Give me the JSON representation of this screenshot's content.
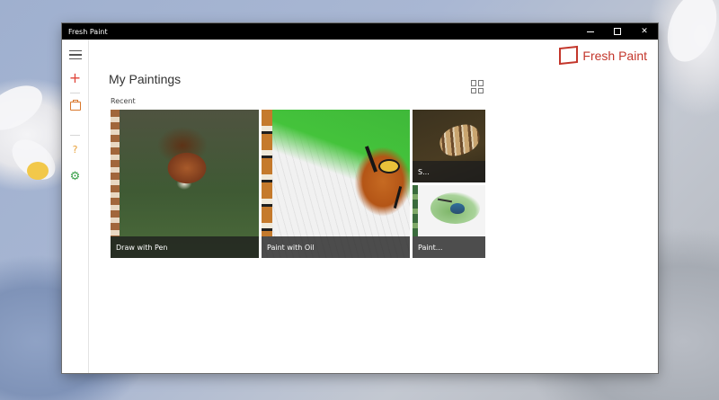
{
  "window": {
    "title": "Fresh Paint"
  },
  "brand": {
    "name": "Fresh Paint",
    "color": "#c3362b"
  },
  "nav": {
    "items": [
      {
        "icon": "hamburger-icon"
      },
      {
        "icon": "plus-icon",
        "glyph": "+",
        "color": "#e0453a"
      },
      {
        "icon": "folder-icon",
        "color": "#d9782d"
      },
      {
        "icon": "help-icon",
        "glyph": "?",
        "color": "#e8a13a"
      },
      {
        "icon": "gear-icon",
        "glyph": "⚙",
        "color": "#3aa04a"
      }
    ]
  },
  "main": {
    "title": "My Paintings",
    "section": "Recent",
    "tiles": [
      {
        "caption": "Draw with Pen"
      },
      {
        "caption": "Paint with Oil"
      },
      {
        "caption": "S..."
      },
      {
        "caption": "Paint..."
      }
    ]
  }
}
